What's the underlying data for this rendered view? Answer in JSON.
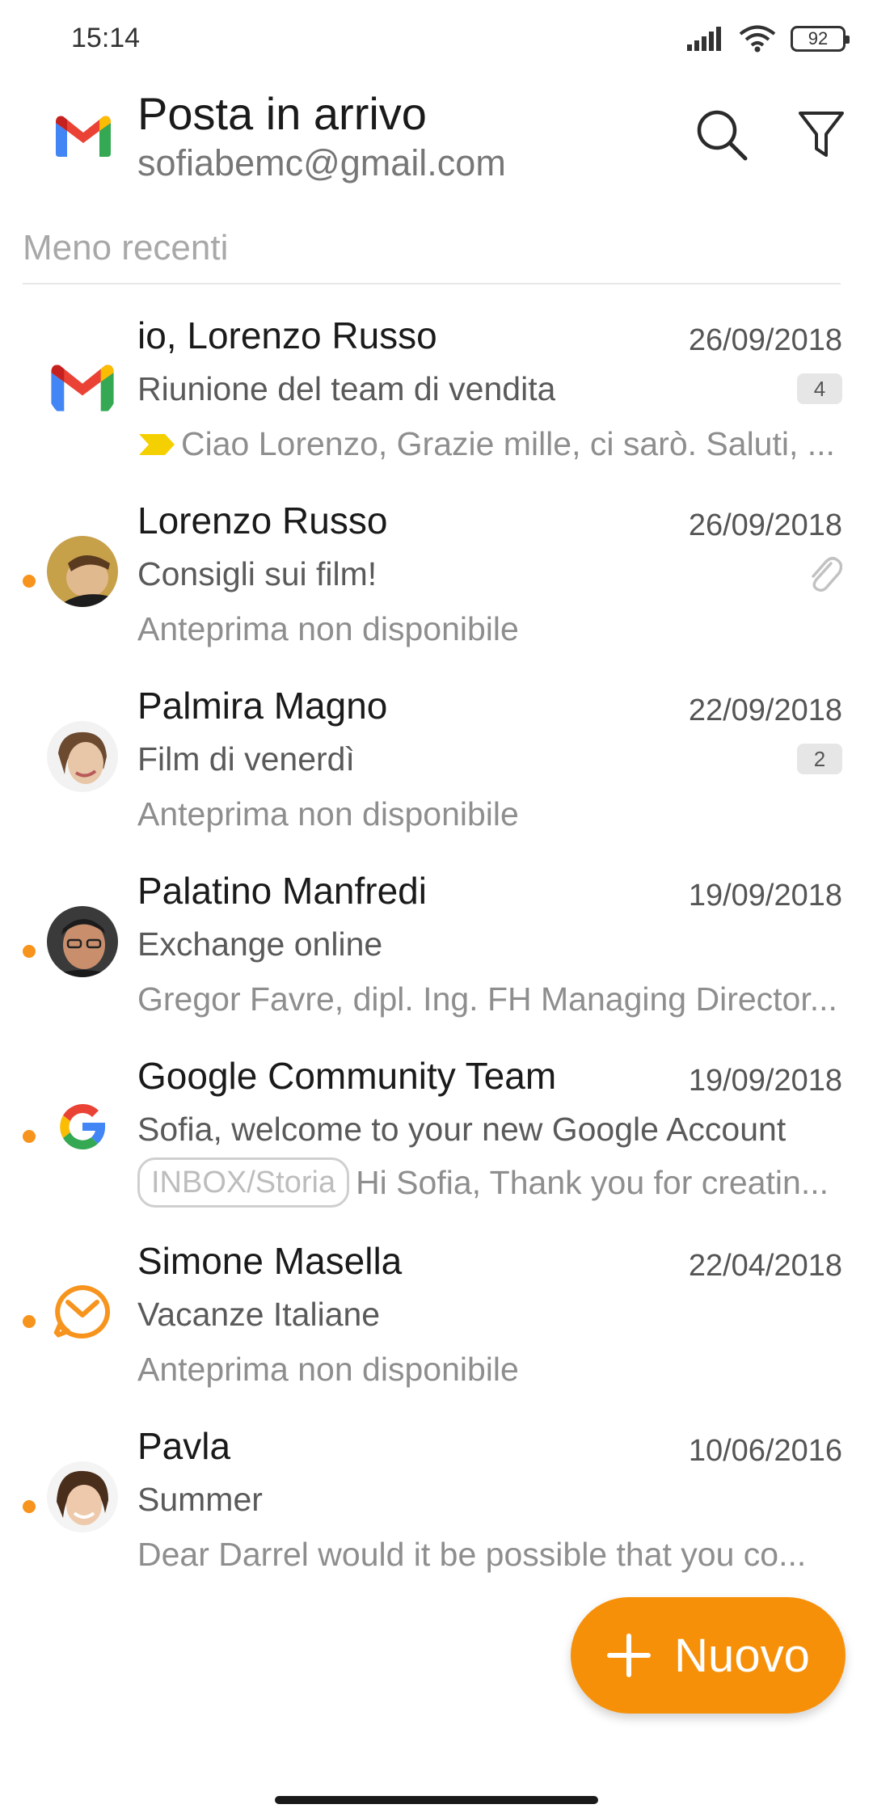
{
  "status_bar": {
    "time": "15:14",
    "battery": "92"
  },
  "header": {
    "title": "Posta in arrivo",
    "account": "sofiabemc@gmail.com",
    "icons": {
      "logo": "gmail-logo",
      "search": "search-icon",
      "filter": "filter-icon"
    }
  },
  "section": {
    "label": "Meno recenti"
  },
  "messages": [
    {
      "sender": "io, Lorenzo Russo",
      "date": "26/09/2018",
      "subject": "Riunione del team di vendita",
      "preview": "Ciao Lorenzo, Grazie mille, ci sarò. Saluti, ...",
      "count": "4",
      "unread": false,
      "avatar": "gmail-logo",
      "important": true
    },
    {
      "sender": "Lorenzo Russo",
      "date": "26/09/2018",
      "subject": "Consigli sui film!",
      "preview": "Anteprima non disponibile",
      "unread": true,
      "avatar": "photo",
      "attachment": true
    },
    {
      "sender": "Palmira Magno",
      "date": "22/09/2018",
      "subject": "Film di venerdì",
      "preview": "Anteprima non disponibile",
      "count": "2",
      "unread": false,
      "avatar": "photo"
    },
    {
      "sender": "Palatino Manfredi",
      "date": "19/09/2018",
      "subject": "Exchange online",
      "preview": "Gregor Favre, dipl. Ing. FH Managing Director...",
      "unread": true,
      "avatar": "photo"
    },
    {
      "sender": "Google Community Team",
      "date": "19/09/2018",
      "subject": "Sofia, welcome to your new Google Account",
      "preview": "Hi Sofia, Thank you for creatin...",
      "label": "INBOX/Storia",
      "unread": true,
      "avatar": "google-logo"
    },
    {
      "sender": "Simone Masella",
      "date": "22/04/2018",
      "subject": "Vacanze Italiane",
      "preview": "Anteprima non disponibile",
      "unread": true,
      "avatar": "envelope-logo"
    },
    {
      "sender": "Pavla",
      "date": "10/06/2016",
      "subject": "Summer",
      "preview": "Dear Darrel would it be possible that you co...",
      "unread": true,
      "avatar": "photo"
    }
  ],
  "fab": {
    "label": "Nuovo",
    "icon": "plus-icon"
  },
  "colors": {
    "accent": "#f79009",
    "unread_dot": "#f7941d",
    "gmail_red": "#ea4335",
    "gmail_blue": "#4285f4",
    "gmail_green": "#34a853",
    "gmail_yellow": "#fbbc04"
  }
}
